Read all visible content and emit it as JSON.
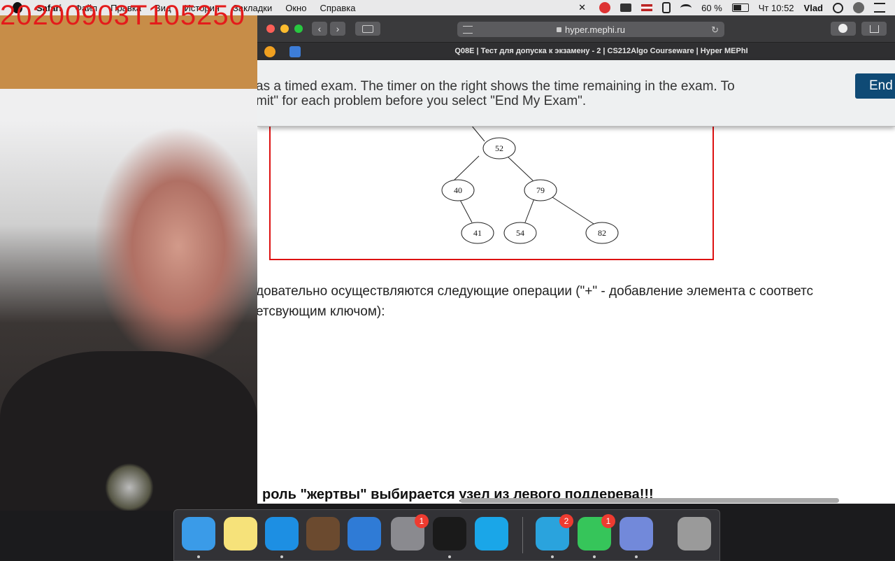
{
  "overlay": {
    "timestamp": "20200903T105250"
  },
  "menubar": {
    "items": [
      "Safari",
      "Файл",
      "Правка",
      "Вид",
      "История",
      "Закладки",
      "Окно",
      "Справка"
    ],
    "status": {
      "battery": "60 %",
      "clock": "Чт 10:52",
      "user": "Vlad"
    }
  },
  "browser": {
    "url": "hyper.mephi.ru",
    "tab_title": "Q08E | Тест для допуска к экзамену - 2 | CS212Algo Courseware | Hyper MEPhI",
    "banner": {
      "text_line1": "as a timed exam. The timer on the right shows the time remaining in the exam. To",
      "text_line2": "mit\" for each problem before you select \"End My Exam\".",
      "end_button": "End"
    },
    "tree": {
      "nodes": [
        "52",
        "40",
        "79",
        "41",
        "54",
        "82"
      ]
    },
    "paragraph": {
      "line1": "довательно осуществляются следующие операции (\"+\" - добавление элемента с соответс",
      "line2": "етсвующим ключом):"
    },
    "bold_note": "роль \"жертвы\" выбирается узел из левого поддерева!!!"
  },
  "dock": {
    "apps": [
      {
        "name": "finder",
        "color": "#3a9be8"
      },
      {
        "name": "notes",
        "color": "#f6e27a"
      },
      {
        "name": "safari",
        "color": "#1d8fe3"
      },
      {
        "name": "garageband",
        "color": "#6b4a2f"
      },
      {
        "name": "xcode",
        "color": "#2f7bd6"
      },
      {
        "name": "system-preferences",
        "color": "#8a8a8f",
        "badge": "1"
      },
      {
        "name": "pycharm",
        "color": "#1a1a1a"
      },
      {
        "name": "skype",
        "color": "#1aa6e8"
      },
      {
        "name": "telegram",
        "color": "#2aa3dd",
        "badge": "2"
      },
      {
        "name": "facetime",
        "color": "#36c55a",
        "badge": "1"
      },
      {
        "name": "discord",
        "color": "#7289da"
      },
      {
        "name": "trash",
        "color": "#9a9a9a"
      }
    ]
  }
}
